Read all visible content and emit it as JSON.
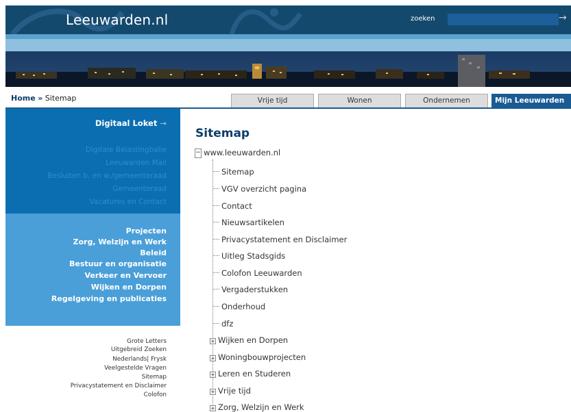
{
  "header": {
    "logo": "Leeuwarden.nl",
    "search_label": "zoeken",
    "search_arrow": "→"
  },
  "breadcrumb": {
    "home": "Home",
    "sep": "»",
    "current": "Sitemap"
  },
  "tabs": [
    {
      "label": "Vrije tijd",
      "active": false
    },
    {
      "label": "Wonen",
      "active": false
    },
    {
      "label": "Ondernemen",
      "active": false
    },
    {
      "label": "Mijn Leeuwarden",
      "active": true
    }
  ],
  "sidebar": {
    "loket": "Digitaal Loket",
    "loket_arrow": "→",
    "loket_links": [
      "Digitale Belastingbalie",
      "Leeuwarden Mail",
      "Besluiten b. en w./gemeenteraad",
      "Gemeenteraad",
      "Vacatures en Contact"
    ],
    "categories": [
      "Projecten",
      "Zorg, Welzijn en Werk",
      "Beleid",
      "Bestuur en organisatie",
      "Verkeer en Vervoer",
      "Wijken en Dorpen",
      "Regelgeving en publicaties"
    ],
    "footer_links": [
      "Grote Letters",
      "Uitgebreid Zoeken",
      "Nederlands| Frysk",
      "Veelgestelde Vragen",
      "Sitemap",
      "Privacystatement en Disclaimer",
      "Colofon"
    ]
  },
  "main": {
    "title": "Sitemap",
    "root": "www.leeuwarden.nl",
    "root_toggle": "−",
    "items": [
      "Sitemap",
      "VGV overzicht pagina",
      "Contact",
      "Nieuwsartikelen",
      "Privacystatement en Disclaimer",
      "Uitleg Stadsgids",
      "Colofon Leeuwarden",
      "Vergaderstukken",
      "Onderhoud",
      "dfz"
    ],
    "expandable": [
      "Wijken en Dorpen",
      "Woningbouwprojecten",
      "Leren en Studeren",
      "Vrije tijd",
      "Zorg, Welzijn en Werk"
    ],
    "expand_toggle": "+"
  }
}
